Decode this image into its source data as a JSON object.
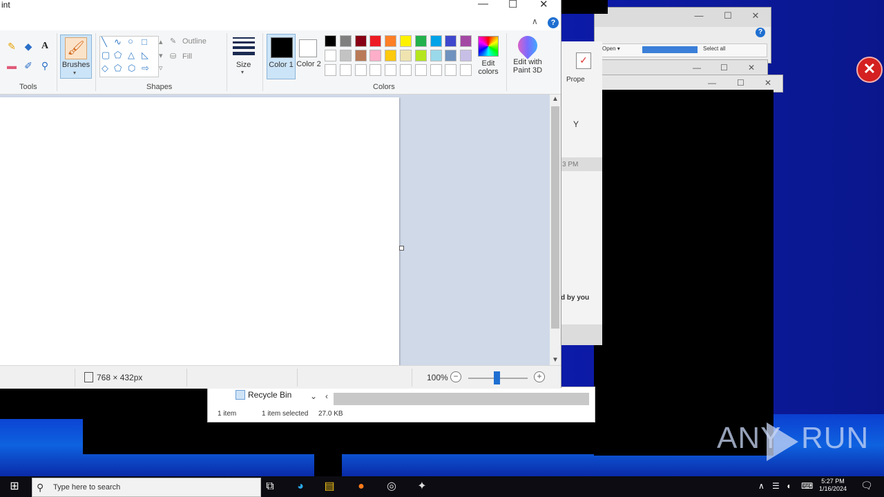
{
  "paint": {
    "title": "int",
    "window_controls": {
      "minimize": "—",
      "maximize": "☐",
      "close": "✕"
    },
    "help": "?",
    "collapse": "∧",
    "groups": {
      "tools": "Tools",
      "shapes": "Shapes",
      "colors": "Colors"
    },
    "brushes_label": "Brushes",
    "outline_label": "Outline",
    "fill_label": "Fill",
    "size_label": "Size",
    "color1_label": "Color 1",
    "color2_label": "Color 2",
    "edit_colors_label": "Edit colors",
    "edit_paint3d_label": "Edit with Paint 3D",
    "palette_row1": [
      "#000000",
      "#7f7f7f",
      "#880015",
      "#ed1c24",
      "#ff7f27",
      "#fff200",
      "#22b14c",
      "#00a2e8",
      "#3f48cc",
      "#a349a4"
    ],
    "palette_row2": [
      "#ffffff",
      "#c3c3c3",
      "#b97a57",
      "#ffaec9",
      "#ffc90e",
      "#efe4b0",
      "#b5e61d",
      "#99d9ea",
      "#7092be",
      "#c8bfe7"
    ],
    "palette_row3": [
      "#ffffff",
      "#ffffff",
      "#ffffff",
      "#ffffff",
      "#ffffff",
      "#ffffff",
      "#ffffff",
      "#ffffff",
      "#ffffff",
      "#ffffff"
    ],
    "color1": "#000000",
    "color2": "#ffffff",
    "status": {
      "dimensions": "768 × 432px",
      "zoom": "100%",
      "zoom_out": "−",
      "zoom_in": "+",
      "zoom_level_fraction": 0.48
    }
  },
  "background_window": {
    "properties_label": "Prope",
    "address_text_left": "Open ▾",
    "address_text_right": "Select all",
    "partial_y": "Y",
    "partial_pm": "3 PM",
    "partial_text": "d by you"
  },
  "explorer": {
    "item_name": "Recycle Bin",
    "status_count": "1 item",
    "status_selected": "1 item selected",
    "status_size": "27.0 KB"
  },
  "watermark": {
    "left": "ANY",
    "right": "RUN"
  },
  "taskbar": {
    "start": "⊞",
    "search_icon": "⚲",
    "search_text": "Type here to search",
    "task_view": "⧉",
    "apps": [
      "edge-icon",
      "file-explorer-icon",
      "firefox-icon",
      "chrome-icon",
      "other-app-icon"
    ],
    "tray_up": "∧",
    "time": "5:27 PM",
    "date": "1/16/2024",
    "notification": "🗨"
  },
  "colors": {
    "accent": "#1f6fd1",
    "desktop": "#0b1fb8",
    "workspace": "#cfd9e8"
  }
}
